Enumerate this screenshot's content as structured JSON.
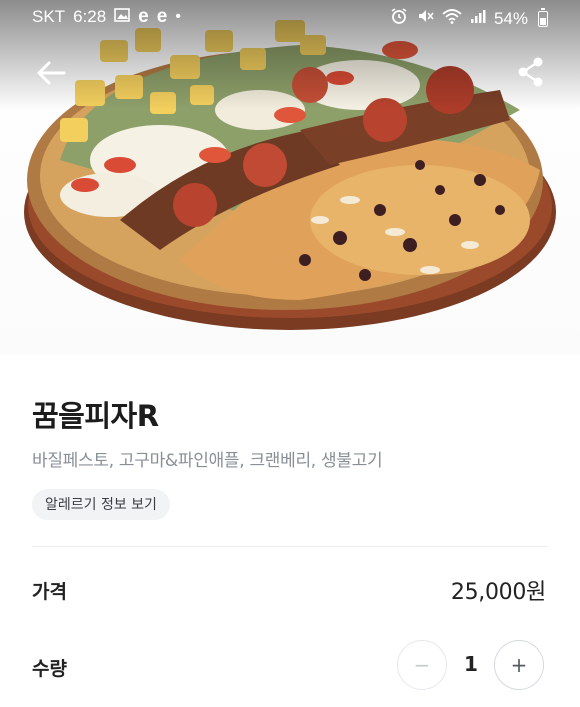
{
  "status_bar": {
    "carrier": "SKT",
    "time": "6:28",
    "battery": "54%",
    "icons": [
      "image-icon",
      "e-app-icon",
      "e-app-icon",
      "dot-icon",
      "alarm-icon",
      "mute-icon",
      "wifi-icon",
      "signal-icon",
      "battery-icon"
    ]
  },
  "app_bar": {
    "back_icon": "arrow-left-icon",
    "share_icon": "share-icon"
  },
  "product": {
    "name": "꿈을피자R",
    "description": "바질페스토, 고구마&파인애플, 크랜베리, 생불고기",
    "allergy_button": "알레르기 정보 보기",
    "image": "pizza-photo"
  },
  "price": {
    "label": "가격",
    "value": "25,000원"
  },
  "quantity": {
    "label": "수량",
    "value": "1",
    "minus": "−",
    "plus": "+"
  },
  "colors": {
    "text_primary": "#1c1c1c",
    "text_secondary": "#8a8f97",
    "chip_bg": "#f1f3f5",
    "divider": "#ebedf0"
  }
}
